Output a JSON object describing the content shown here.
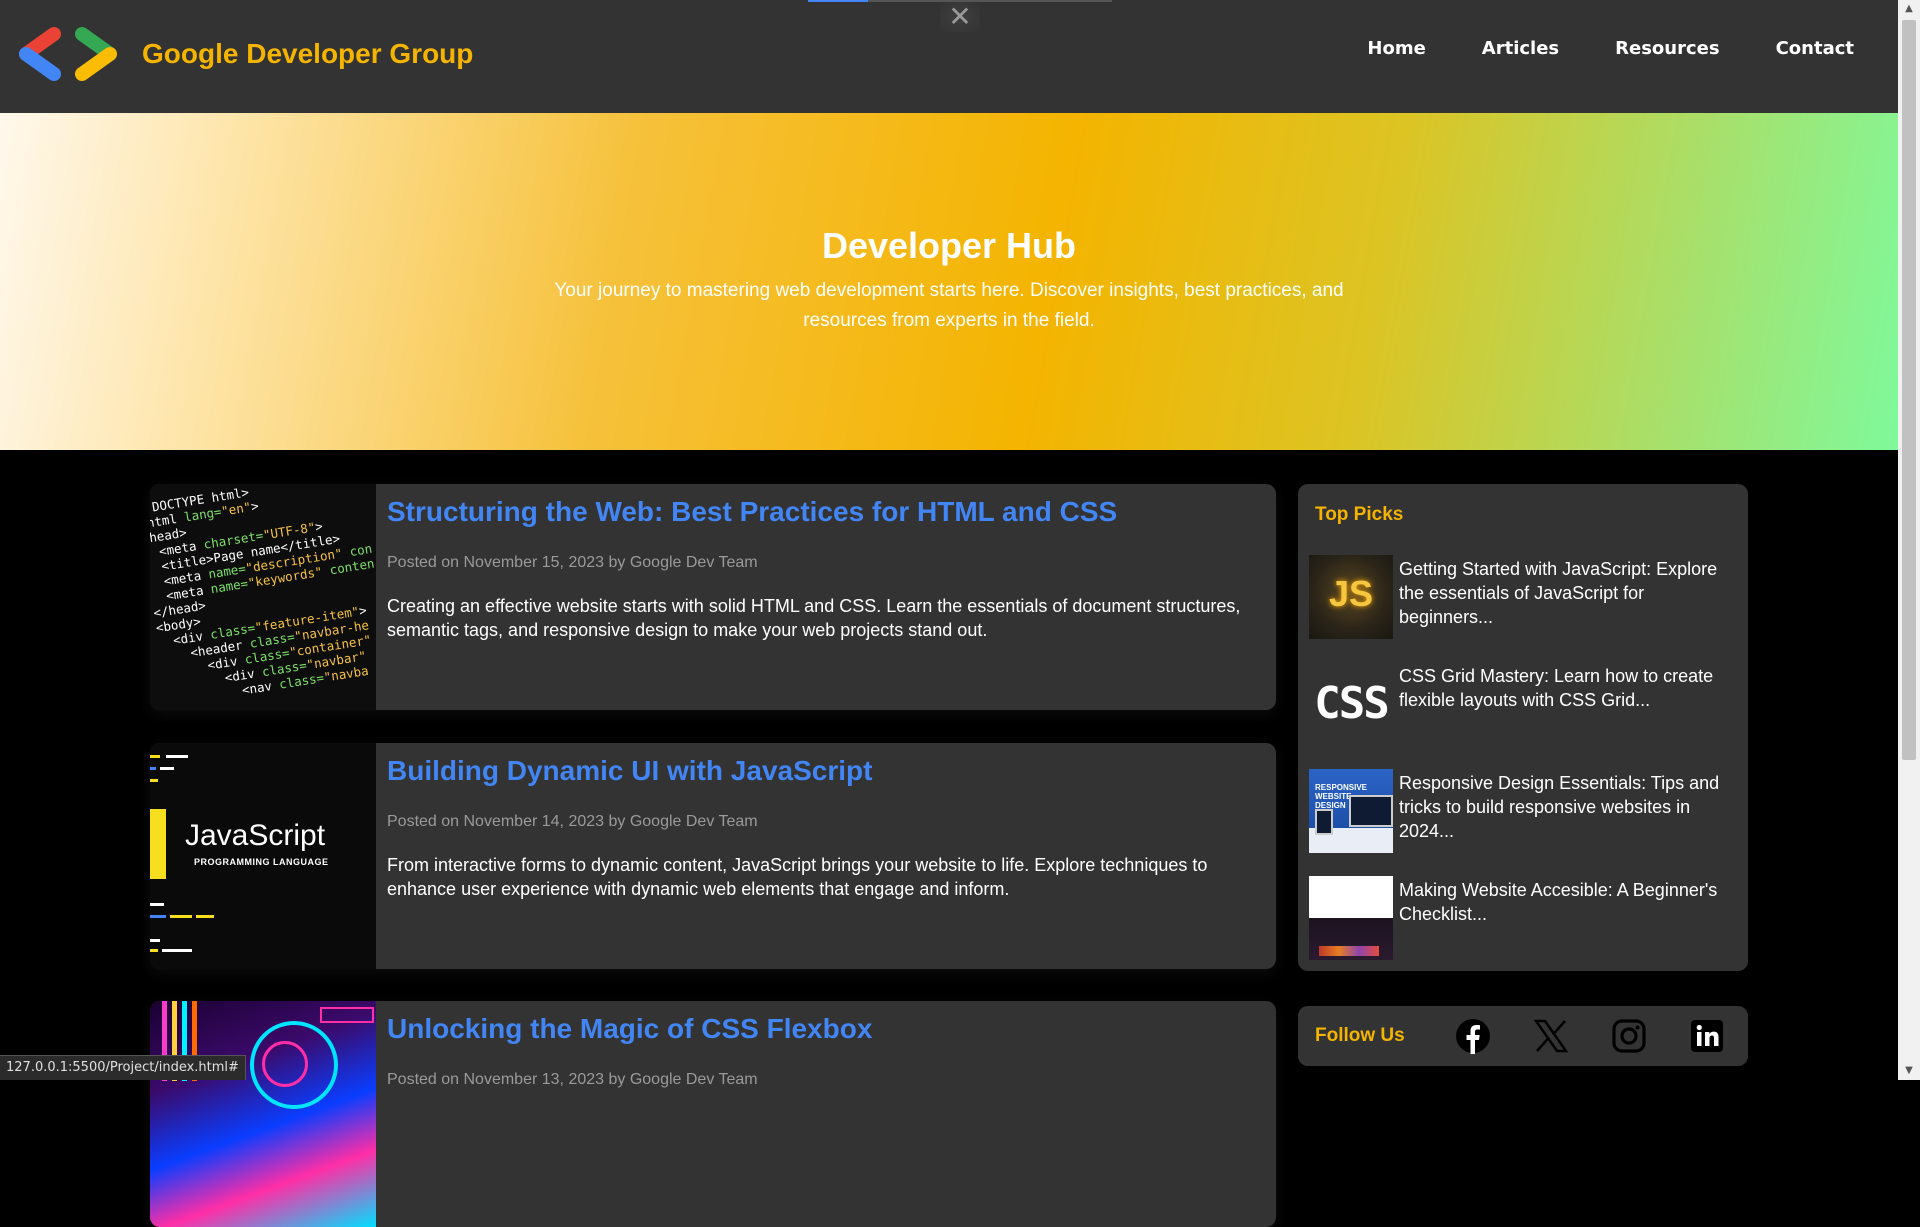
{
  "navbar": {
    "brand": "Google Developer Group",
    "logo_icon": "gdg-logo-icon",
    "links": [
      "Home",
      "Articles",
      "Resources",
      "Contact"
    ],
    "close_symbol": "✕"
  },
  "hero": {
    "title": "Developer Hub",
    "subtitle": "Your journey to mastering web development starts here. Discover insights, best practices, and resources from experts in the field."
  },
  "articles": [
    {
      "title": "Structuring the Web: Best Practices for HTML and CSS",
      "meta": "Posted on November 15, 2023 by Google Dev Team",
      "description": "Creating an effective website starts with solid HTML and CSS. Learn the essentials of document structures, semantic tags, and responsive design to make your web projects stand out.",
      "image": "html-code-image"
    },
    {
      "title": "Building Dynamic UI with JavaScript",
      "meta": "Posted on November 14, 2023 by Google Dev Team",
      "description": "From interactive forms to dynamic content, JavaScript brings your website to life. Explore techniques to enhance user experience with dynamic web elements that engage and inform.",
      "image": "javascript-image",
      "image_text": "JavaScript",
      "image_subtext": "PROGRAMMING LANGUAGE"
    },
    {
      "title": "Unlocking the Magic of CSS Flexbox",
      "meta": "Posted on November 13, 2023 by Google Dev Team",
      "description": "",
      "image": "neon-css-image"
    }
  ],
  "top_picks": {
    "heading": "Top Picks",
    "items": [
      {
        "text": "Getting Started with JavaScript: Explore the essentials of JavaScript for beginners...",
        "image": "js-logo-thumb",
        "image_text": "JS"
      },
      {
        "text": "CSS Grid Mastery: Learn how to create flexible layouts with CSS Grid...",
        "image": "css-logo-thumb",
        "image_text": "CSS"
      },
      {
        "text": "Responsive Design Essentials: Tips and tricks to build responsive websites in 2024...",
        "image": "responsive-design-thumb",
        "image_text": "RESPONSIVE WEBSITE DESIGN"
      },
      {
        "text": "Making Website Accesible: A Beginner's Checklist...",
        "image": "accessibility-thumb"
      }
    ]
  },
  "follow": {
    "label": "Follow Us",
    "icons": [
      "facebook-icon",
      "x-icon",
      "instagram-icon",
      "linkedin-icon"
    ]
  },
  "status_url": "127.0.0.1:5500/Project/index.html#",
  "colors": {
    "brand_yellow": "#f4b400",
    "link_blue": "#4285f4",
    "card_bg": "#333333",
    "page_bg": "#000000"
  }
}
